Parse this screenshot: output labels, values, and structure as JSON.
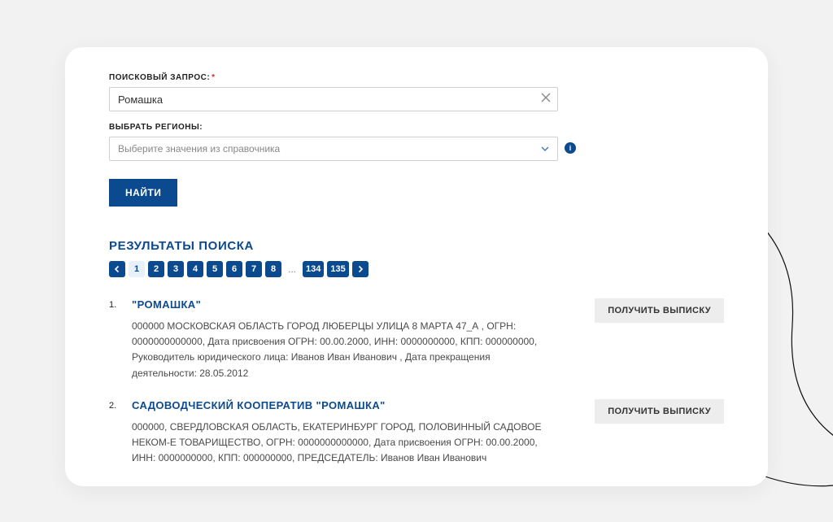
{
  "form": {
    "search_label": "ПОИСКОВЫЙ ЗАПРОС:",
    "search_value": "Ромашка",
    "region_label": "ВЫБРАТЬ РЕГИОНЫ:",
    "region_placeholder": "Выберите значения из справочника",
    "submit_label": "НАЙТИ"
  },
  "results": {
    "heading": "РЕЗУЛЬТАТЫ ПОИСКА",
    "pages": [
      "1",
      "2",
      "3",
      "4",
      "5",
      "6",
      "7",
      "8"
    ],
    "ellipsis": "...",
    "tail_pages": [
      "134",
      "135"
    ],
    "current_page": "1",
    "extract_label": "ПОЛУЧИТЬ ВЫПИСКУ",
    "items": [
      {
        "num": "1.",
        "title": "\"РОМАШКА\"",
        "desc": "000000 МОСКОВСКАЯ ОБЛАСТЬ ГОРОД ЛЮБЕРЦЫ УЛИЦА 8 МАРТА 47_А , ОГРН: 0000000000000, Дата присвоения ОГРН: 00.00.2000, ИНН: 0000000000, КПП: 000000000, Руководитель юридического лица: Иванов Иван Иванович , Дата прекращения деятельности: 28.05.2012"
      },
      {
        "num": "2.",
        "title": "САДОВОДЧЕСКИЙ КООПЕРАТИВ \"РОМАШКА\"",
        "desc": "000000, СВЕРДЛОВСКАЯ ОБЛАСТЬ, ЕКАТЕРИНБУРГ ГОРОД, ПОЛОВИННЫЙ САДОВОЕ НЕКОМ-Е ТОВАРИЩЕСТВО, ОГРН: 0000000000000, Дата присвоения ОГРН: 00.00.2000, ИНН: 0000000000, КПП: 000000000, ПРЕДСЕДАТЕЛЬ: Иванов Иван Иванович"
      }
    ]
  }
}
